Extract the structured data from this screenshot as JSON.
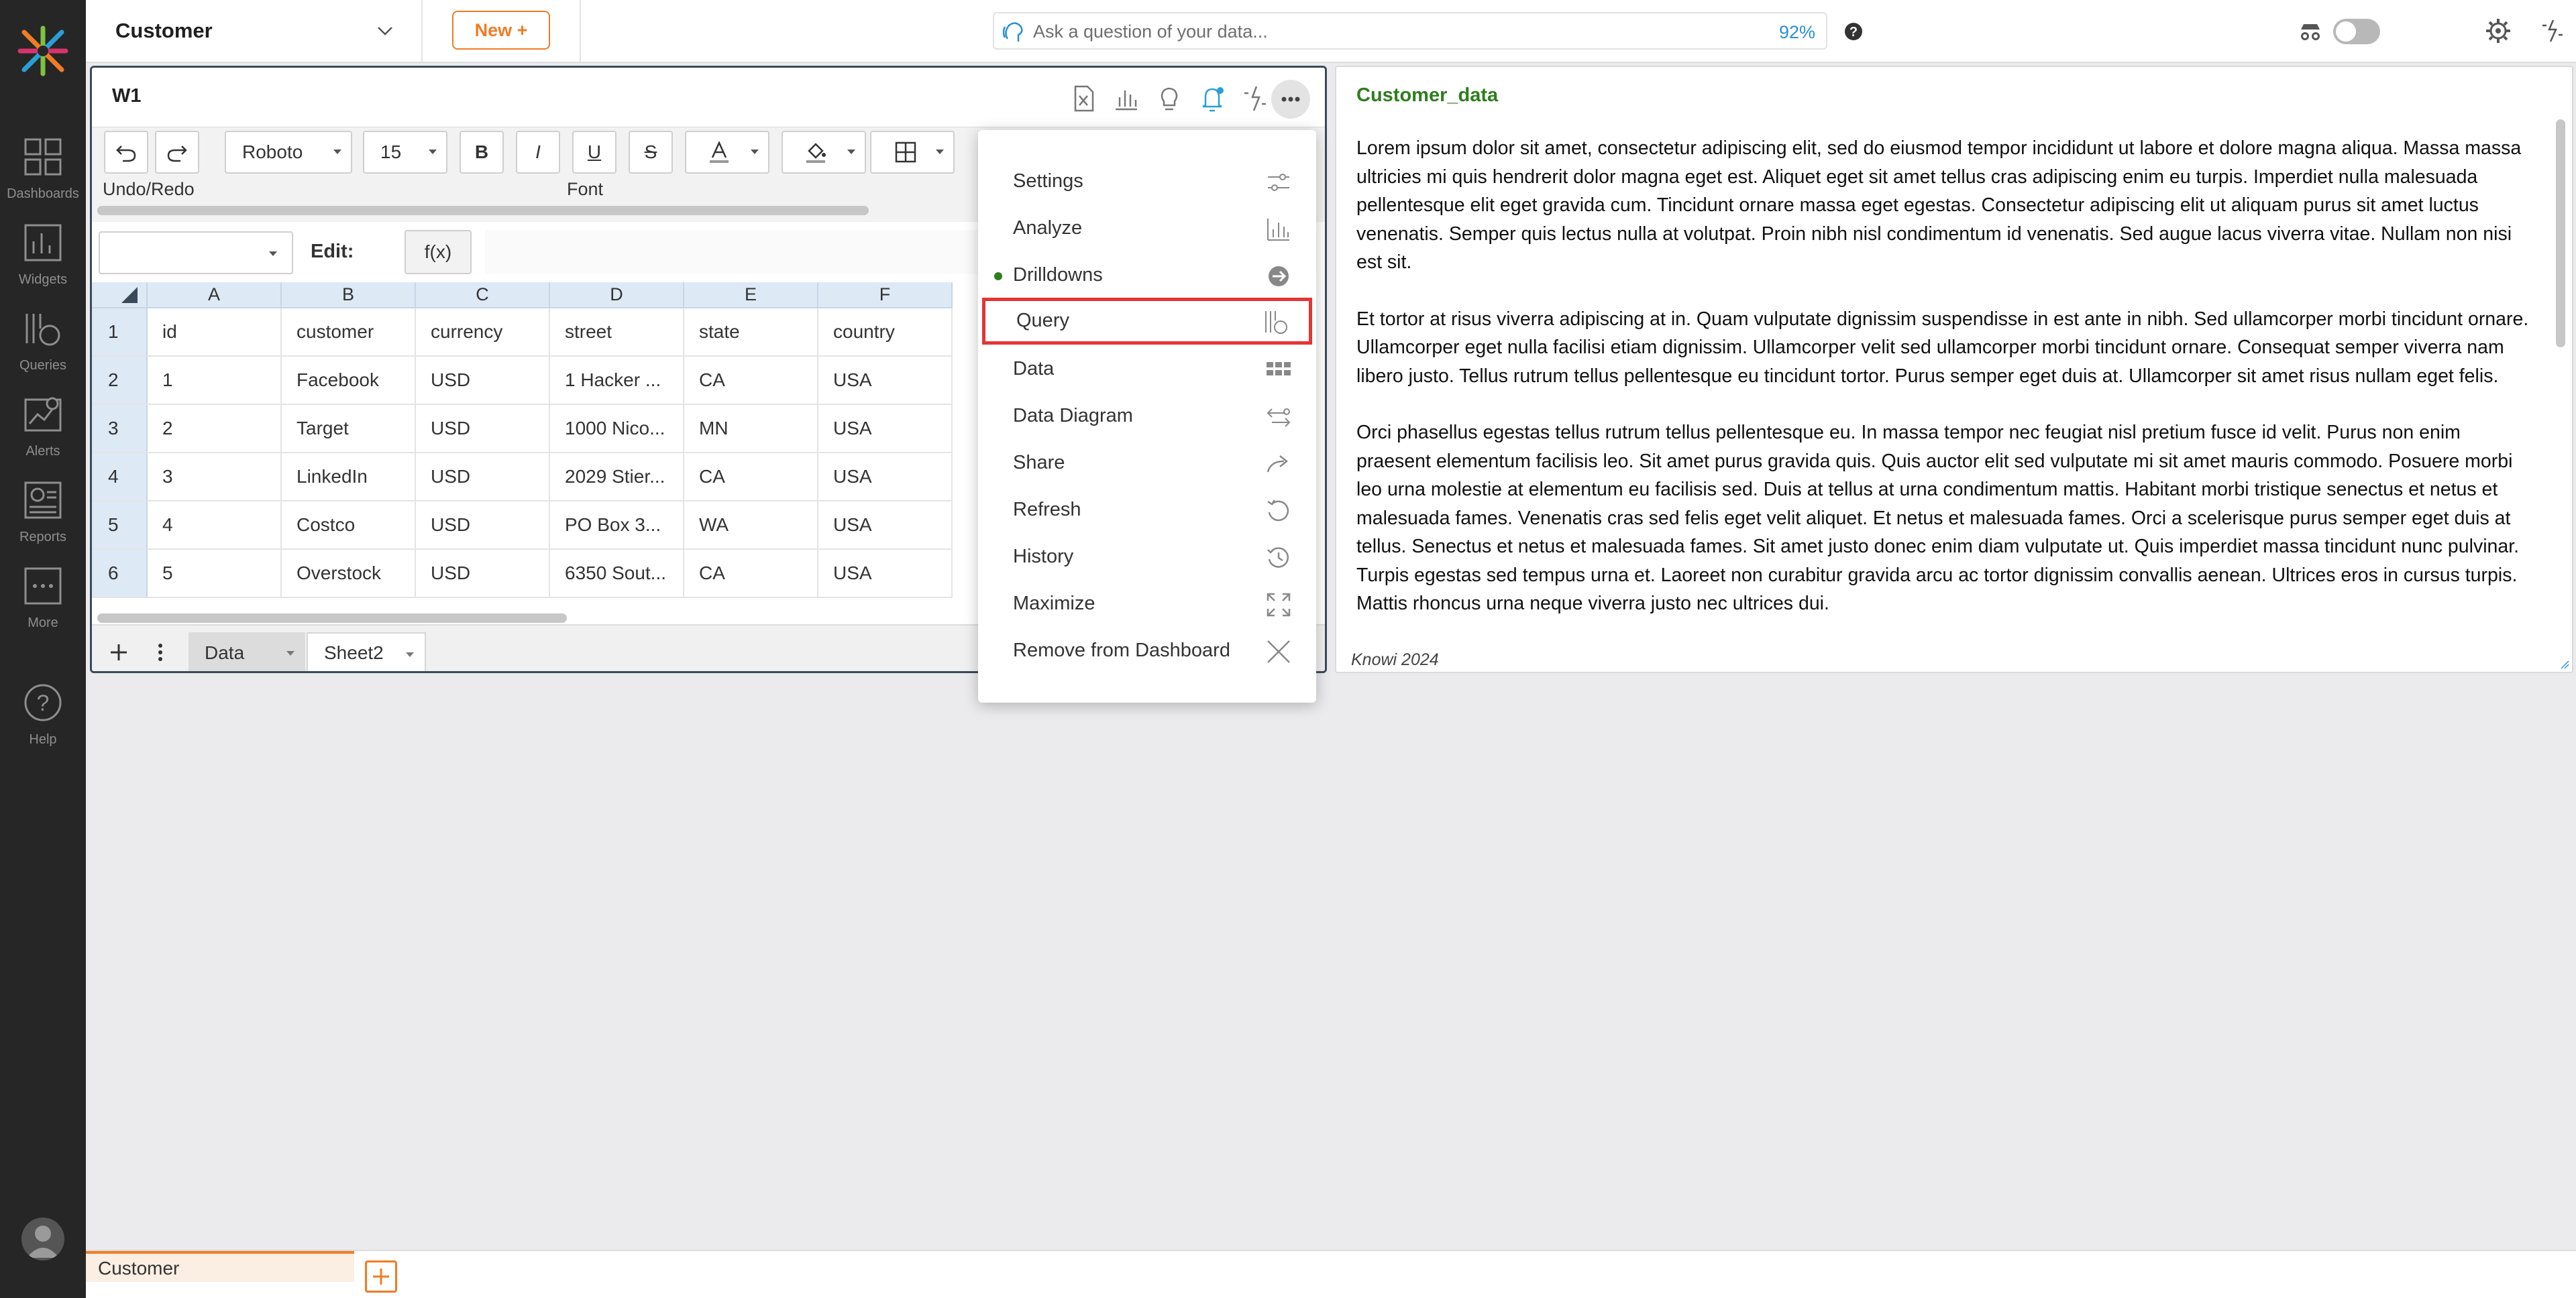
{
  "nav": {
    "items": [
      {
        "label": "Dashboards",
        "icon": "dashboards-icon"
      },
      {
        "label": "Widgets",
        "icon": "widgets-icon"
      },
      {
        "label": "Queries",
        "icon": "queries-icon"
      },
      {
        "label": "Alerts",
        "icon": "alerts-icon"
      },
      {
        "label": "Reports",
        "icon": "reports-icon"
      },
      {
        "label": "More",
        "icon": "more-icon"
      }
    ],
    "help_label": "Help"
  },
  "topbar": {
    "title": "Customer",
    "new_label": "New +",
    "ask_placeholder": "Ask a question of your data...",
    "ask_percent": "92%"
  },
  "widget1": {
    "title": "W1",
    "ribbon": {
      "font_name": "Roboto",
      "font_size": "15",
      "bold": "B",
      "italic": "I",
      "underline": "U",
      "strike": "S",
      "undo_redo_label": "Undo/Redo",
      "font_label": "Font"
    },
    "edit_label": "Edit:",
    "fx_label": "f(x)",
    "grid": {
      "columns": [
        "A",
        "B",
        "C",
        "D",
        "E",
        "F"
      ],
      "rows": [
        {
          "num": "1",
          "cells": [
            "id",
            "customer",
            "currency",
            "street",
            "state",
            "country"
          ]
        },
        {
          "num": "2",
          "cells": [
            "1",
            "Facebook",
            "USD",
            "1 Hacker ...",
            "CA",
            "USA"
          ]
        },
        {
          "num": "3",
          "cells": [
            "2",
            "Target",
            "USD",
            "1000 Nico...",
            "MN",
            "USA"
          ]
        },
        {
          "num": "4",
          "cells": [
            "3",
            "LinkedIn",
            "USD",
            "2029 Stier...",
            "CA",
            "USA"
          ]
        },
        {
          "num": "5",
          "cells": [
            "4",
            "Costco",
            "USD",
            "PO Box 3...",
            "WA",
            "USA"
          ]
        },
        {
          "num": "6",
          "cells": [
            "5",
            "Overstock",
            "USD",
            "6350 Sout...",
            "CA",
            "USA"
          ]
        }
      ]
    },
    "sheets": [
      "Data",
      "Sheet2"
    ]
  },
  "menu": {
    "items": [
      {
        "label": "Settings",
        "icon": "sliders-icon"
      },
      {
        "label": "Analyze",
        "icon": "bar-chart-icon"
      },
      {
        "label": "Drilldowns",
        "icon": "arrow-circle-icon"
      },
      {
        "label": "Query",
        "icon": "query-icon"
      },
      {
        "label": "Data",
        "icon": "data-grid-icon"
      },
      {
        "label": "Data Diagram",
        "icon": "diagram-icon"
      },
      {
        "label": "Share",
        "icon": "share-icon"
      },
      {
        "label": "Refresh",
        "icon": "refresh-icon"
      },
      {
        "label": "History",
        "icon": "history-icon"
      },
      {
        "label": "Maximize",
        "icon": "maximize-icon"
      },
      {
        "label": "Remove from Dashboard",
        "icon": "close-icon"
      }
    ],
    "selected": "Query"
  },
  "widget2": {
    "title": "Customer_data",
    "paragraphs": [
      "Lorem ipsum dolor sit amet, consectetur adipiscing elit, sed do eiusmod tempor incididunt ut labore et dolore magna aliqua. Massa massa ultricies mi quis hendrerit dolor magna eget est. Aliquet eget sit amet tellus cras adipiscing enim eu turpis. Imperdiet nulla malesuada pellentesque elit eget gravida cum. Tincidunt ornare massa eget egestas. Consectetur adipiscing elit ut aliquam purus sit amet luctus venenatis. Semper quis lectus nulla at volutpat. Proin nibh nisl condimentum id venenatis. Sed augue lacus viverra vitae. Nullam non nisi est sit.",
      "Et tortor at risus viverra adipiscing at in. Quam vulputate dignissim suspendisse in est ante in nibh. Sed ullamcorper morbi tincidunt ornare. Ullamcorper eget nulla facilisi etiam dignissim. Ullamcorper velit sed ullamcorper morbi tincidunt ornare. Consequat semper viverra nam libero justo. Tellus rutrum tellus pellentesque eu tincidunt tortor. Purus semper eget duis at. Ullamcorper sit amet risus nullam eget felis.",
      "Orci phasellus egestas tellus rutrum tellus pellentesque eu. In massa tempor nec feugiat nisl pretium fusce id velit. Purus non enim praesent elementum facilisis leo. Sit amet purus gravida quis. Quis auctor elit sed vulputate mi sit amet mauris commodo. Posuere morbi leo urna molestie at elementum eu facilisis sed. Duis at tellus at urna condimentum mattis. Habitant morbi tristique senectus et netus et malesuada fames. Venenatis cras sed felis eget velit aliquet. Et netus et malesuada fames. Orci a scelerisque purus semper eget duis at tellus. Senectus et netus et malesuada fames. Sit amet justo donec enim diam vulputate ut. Quis imperdiet massa tincidunt nunc pulvinar. Turpis egestas sed tempus urna et. Laoreet non curabitur gravida arcu ac tortor dignissim convallis aenean. Ultrices eros in cursus turpis. Mattis rhoncus urna neque viverra justo nec ultrices dui."
    ],
    "footer": "Knowi 2024"
  },
  "bottom": {
    "tab_label": "Customer"
  },
  "colors": {
    "accent": "#f07c24",
    "nav_bg": "#262626",
    "link_blue": "#2a8fd6",
    "green_title": "#2e7d1e",
    "highlight_red": "#e53535"
  }
}
